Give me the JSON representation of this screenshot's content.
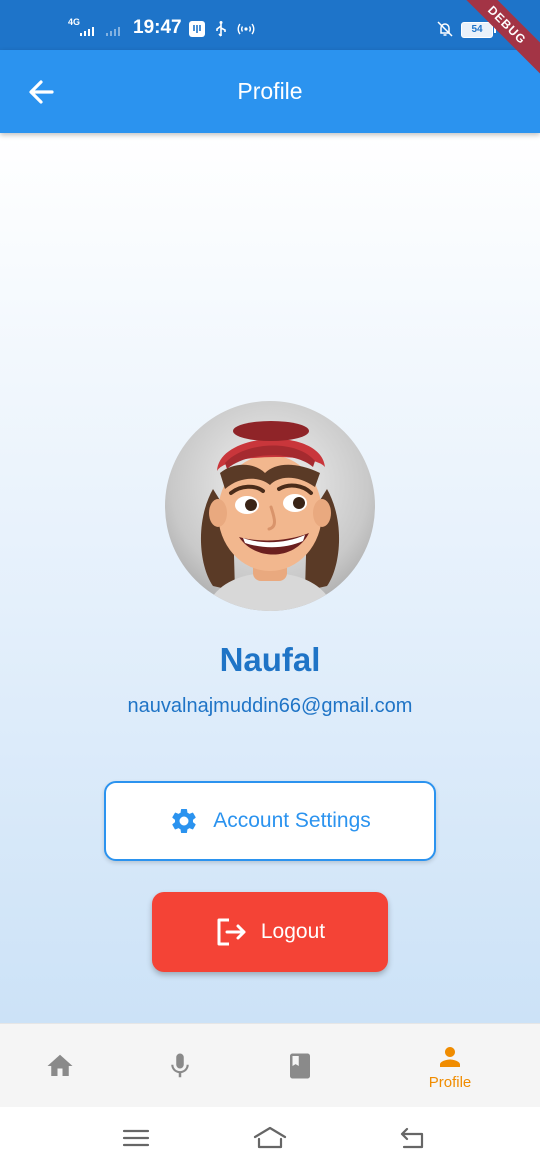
{
  "status_bar": {
    "network": "4G",
    "time": "19:47",
    "battery": "54"
  },
  "debug_banner": "DEBUG",
  "app_bar": {
    "title": "Profile",
    "back_icon": "arrow-left-icon"
  },
  "profile": {
    "name": "Naufal",
    "email": "nauvalnajmuddin66@gmail.com",
    "avatar_icon": "avatar-cartoon-boy-red-cap"
  },
  "actions": {
    "settings_label": "Account Settings",
    "settings_icon": "gear-icon",
    "logout_label": "Logout",
    "logout_icon": "logout-icon"
  },
  "bottom_nav": {
    "items": [
      {
        "icon": "home-icon",
        "label": ""
      },
      {
        "icon": "mic-icon",
        "label": ""
      },
      {
        "icon": "book-icon",
        "label": ""
      },
      {
        "icon": "person-icon",
        "label": "Profile",
        "active": true
      }
    ],
    "active_color": "#f08c00",
    "inactive_color": "#8a8a8a"
  },
  "colors": {
    "primary": "#2b93ef",
    "status_bar": "#1e74c9",
    "text_primary": "#1f74c6",
    "danger": "#f44336"
  }
}
